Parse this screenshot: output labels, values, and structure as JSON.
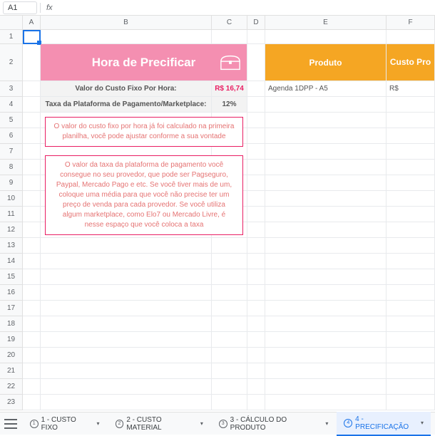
{
  "nameBox": "A1",
  "columns": [
    "A",
    "B",
    "C",
    "D",
    "E",
    "F"
  ],
  "rowCount": 23,
  "banners": {
    "pink": "Hora de Precificar",
    "orangeLeft": "Produto",
    "orangeRight": "Custo Pro"
  },
  "infoRows": {
    "r3": {
      "label": "Valor do Custo Fixo Por Hora:",
      "value": "R$ 16,74"
    },
    "r4": {
      "label": "Taxa da Plataforma de Pagamento/Marketplace:",
      "value": "12%"
    }
  },
  "product": {
    "name": "Agenda 1DPP - A5",
    "costPrefix": "R$"
  },
  "infoBox1": "O valor do custo fixo por hora já foi calculado na primeira planilha, você pode ajustar conforme a sua vontade",
  "infoBox2": "O valor da taxa da plataforma de pagamento você consegue no seu provedor, que pode ser Pagseguro, Paypal, Mercado Pago e etc. Se você tiver mais de um, coloque uma média para que você não precise ter um preço de venda para cada provedor. Se você utiliza algum marketplace, como Elo7 ou Mercado Livre, é nesse espaço que você coloca a taxa",
  "tabs": [
    {
      "num": "1",
      "label": "1 - CUSTO FIXO"
    },
    {
      "num": "2",
      "label": "2 - CUSTO MATERIAL"
    },
    {
      "num": "3",
      "label": "3 - CÁLCULO DO PRODUTO"
    },
    {
      "num": "4",
      "label": "4 - PRECIFICAÇÃO"
    }
  ],
  "activeTab": 3
}
